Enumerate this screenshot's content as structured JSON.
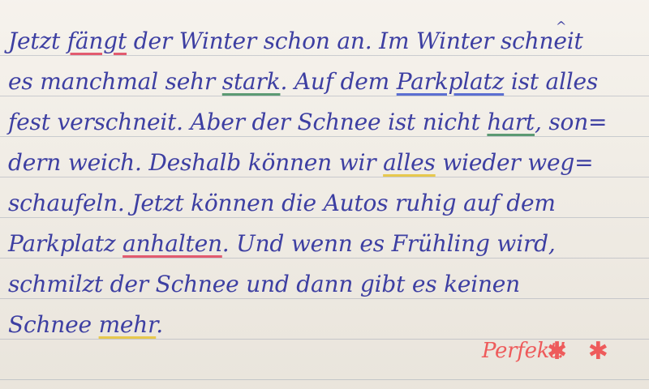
{
  "document": {
    "lines": [
      [
        "Jetzt ",
        "fängt",
        " der Winter schon an. Im Winter schneit"
      ],
      [
        "es manchmal sehr ",
        "stark",
        ". Auf dem ",
        "Parkplatz",
        " ist alles"
      ],
      [
        "fest verschneit. Aber der Schnee ist nicht ",
        "hart",
        ", son="
      ],
      [
        "dern weich. Deshalb können wir ",
        "alles",
        " wieder weg="
      ],
      [
        "schaufeln. Jetzt können die Autos ruhig auf dem"
      ],
      [
        "Parkplatz ",
        "anhalten",
        ". Und wenn es Frühling wird,"
      ],
      [
        "schmilzt der Schnee und dann gibt es keinen"
      ],
      [
        "Schnee ",
        "mehr",
        "."
      ]
    ],
    "insertion_mark": "^",
    "teacher_note": "Perfekt!",
    "stars": [
      "✱",
      "✱"
    ],
    "colors": {
      "ink": "#3d3fa2",
      "red_pen": "#ee5b5b",
      "underline_red": "#e25b6f",
      "underline_green": "#5c9a73",
      "underline_blue": "#5c6fd1",
      "underline_yellow": "#e7c84d"
    }
  }
}
